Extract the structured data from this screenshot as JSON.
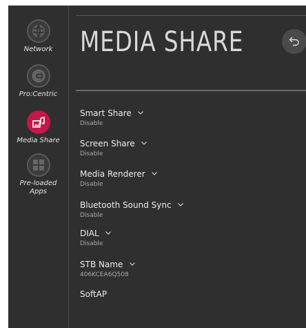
{
  "sidebar": {
    "items": [
      {
        "label": "Network",
        "icon": "globe-icon",
        "active": false
      },
      {
        "label": "Pro:Centric",
        "icon": "pro-centric-icon",
        "active": false
      },
      {
        "label": "Media Share",
        "icon": "media-share-icon",
        "active": true
      },
      {
        "label": "Pre-loaded Apps",
        "icon": "apps-grid-icon",
        "active": false
      }
    ],
    "accent_color": "#c4174b"
  },
  "header": {
    "title": "MEDIA SHARE",
    "back_icon": "back-arrow-icon"
  },
  "settings": [
    {
      "name": "Smart Share",
      "value": "Disable",
      "has_dropdown": true
    },
    {
      "name": "Screen Share",
      "value": "Disable",
      "has_dropdown": true
    },
    {
      "name": "Media Renderer",
      "value": "Disable",
      "has_dropdown": true
    },
    {
      "name": "Bluetooth Sound Sync",
      "value": "Disable",
      "has_dropdown": true
    },
    {
      "name": "DIAL",
      "value": "Disable",
      "has_dropdown": true
    },
    {
      "name": "STB Name",
      "value": "406KCEA6Q508",
      "has_dropdown": true
    },
    {
      "name": "SoftAP",
      "value": "",
      "has_dropdown": false
    }
  ]
}
